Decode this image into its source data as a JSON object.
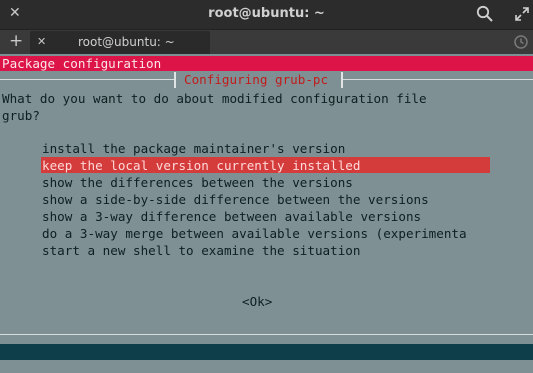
{
  "window": {
    "title": "root@ubuntu: ~",
    "close_glyph": "✕",
    "search_icon": "search-icon",
    "fullscreen_icon": "expand-icon"
  },
  "tabs": {
    "new_tab_glyph": "+",
    "close_tab_glyph": "✕",
    "active_tab_label": "root@ubuntu: ~",
    "history_icon": "history-icon"
  },
  "dialog": {
    "header": "Package configuration",
    "title": "Configuring grub-pc",
    "question_line1": "What do you want to do about modified configuration file",
    "question_line2": "grub?",
    "options": [
      "install the package maintainer's version",
      "keep the local version currently installed",
      "show the differences between the versions",
      "show a side-by-side difference between the versions",
      "show a 3-way difference between available versions",
      "do a 3-way merge between available versions (experimenta",
      "start a new shell to examine the situation"
    ],
    "selected_index": 1,
    "ok_label": "<Ok>"
  },
  "colors": {
    "terminal_bg": "#7f9094",
    "header_bar": "#dd1447",
    "selection": "#d43b3b",
    "dialog_title": "#c11c1c",
    "bottom_band": "#0e3e4a"
  }
}
